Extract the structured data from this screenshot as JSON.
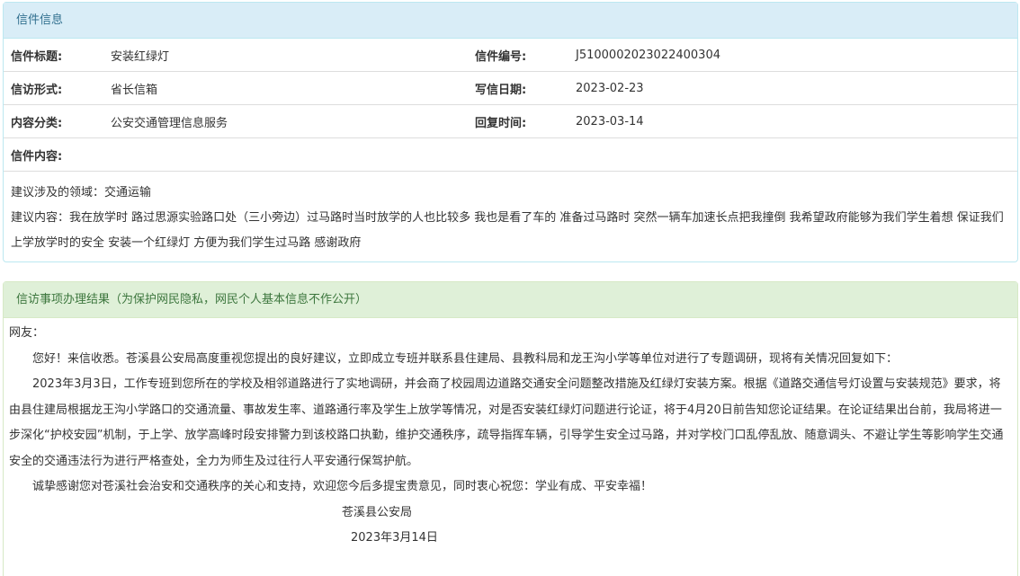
{
  "letter": {
    "heading": "信件信息",
    "rows": [
      {
        "label1": "信件标题:",
        "value1": "安装红绿灯",
        "label2": "信件编号:",
        "value2": "J5100002023022400304"
      },
      {
        "label1": "信访形式:",
        "value1": "省长信箱",
        "label2": "写信日期:",
        "value2": "2023-02-23"
      },
      {
        "label1": "内容分类:",
        "value1": "公安交通管理信息服务",
        "label2": "回复时间:",
        "value2": "2023-03-14"
      }
    ],
    "content_label": "信件内容:",
    "content_lines": [
      "建议涉及的领域：交通运输",
      "建议内容：我在放学时 路过思源实验路口处（三小旁边）过马路时当时放学的人也比较多 我也是看了车的 准备过马路时 突然一辆车加速长点把我撞倒 我希望政府能够为我们学生着想 保证我们上学放学时的安全 安装一个红绿灯 方便为我们学生过马路 感谢政府"
    ]
  },
  "result": {
    "heading": "信访事项办理结果（为保护网民隐私，网民个人基本信息不作公开）",
    "greeting": "网友：",
    "paragraphs": [
      "您好！来信收悉。苍溪县公安局高度重视您提出的良好建议，立即成立专班并联系县住建局、县教科局和龙王沟小学等单位对进行了专题调研，现将有关情况回复如下：",
      "2023年3月3日，工作专班到您所在的学校及相邻道路进行了实地调研，并会商了校园周边道路交通安全问题整改措施及红绿灯安装方案。根据《道路交通信号灯设置与安装规范》要求，将由县住建局根据龙王沟小学路口的交通流量、事故发生率、道路通行率及学生上放学等情况，对是否安装红绿灯问题进行论证，将于4月20日前告知您论证结果。在论证结果出台前，我局将进一步深化“护校安园”机制，于上学、放学高峰时段安排警力到该校路口执勤，维护交通秩序，疏导指挥车辆，引导学生安全过马路，并对学校门口乱停乱放、随意调头、不避让学生等影响学生交通安全的交通违法行为进行严格查处，全力为师生及过往行人平安通行保驾护航。",
      "诚挚感谢您对苍溪社会治安和交通秩序的关心和支持，欢迎您今后多提宝贵意见，同时衷心祝您：学业有成、平安幸福！"
    ],
    "signature": "苍溪县公安局",
    "date": "2023年3月14日"
  }
}
